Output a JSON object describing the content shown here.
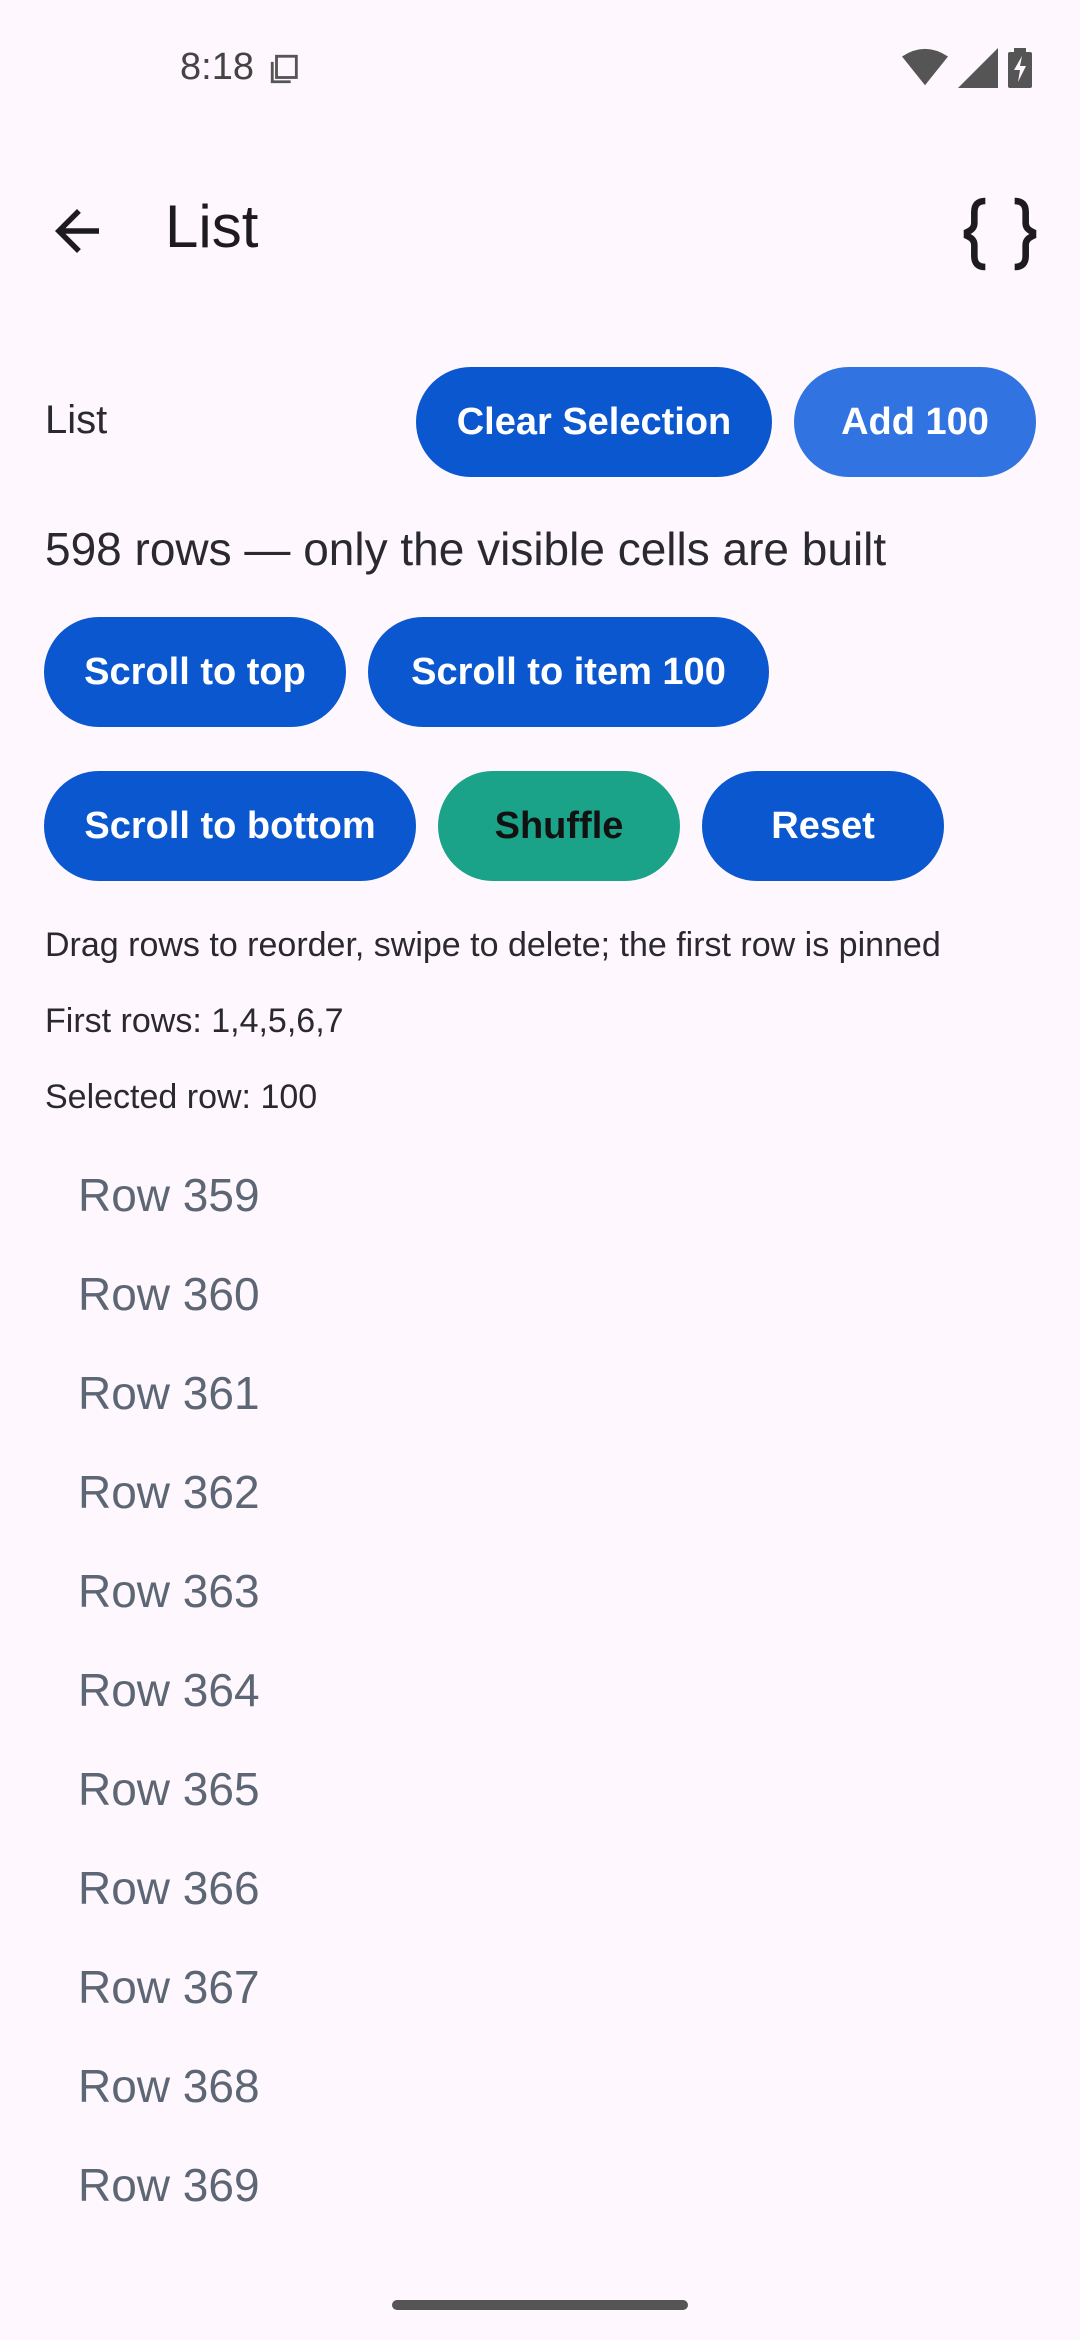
{
  "status_bar": {
    "time": "8:18",
    "icons": [
      "sim-card-icon",
      "wifi-icon",
      "signal-icon",
      "battery-charging-icon"
    ]
  },
  "app_bar": {
    "title": "List",
    "back_icon": "arrow-back-icon",
    "action_icon": "code-braces-icon"
  },
  "header": {
    "label": "List",
    "clear_selection_label": "Clear Selection",
    "add_label": "Add 100"
  },
  "info": "598 rows — only the visible cells are built",
  "controls": {
    "scroll_top_label": "Scroll to top",
    "scroll_item_label": "Scroll to item 100",
    "scroll_bottom_label": "Scroll to bottom",
    "shuffle_label": "Shuffle",
    "reset_label": "Reset"
  },
  "hint": "Drag rows to reorder, swipe to delete; the first row is pinned",
  "first_rows": "First rows: 1,4,5,6,7",
  "selected_row": "Selected row: 100",
  "rows": [
    "Row 359",
    "Row 360",
    "Row 361",
    "Row 362",
    "Row 363",
    "Row 364",
    "Row 365",
    "Row 366",
    "Row 367",
    "Row 368",
    "Row 369"
  ],
  "colors": {
    "primary": "#0B57D0",
    "primary_light": "#3173E0",
    "teal": "#1BA38A",
    "background": "#FEF7FD",
    "row_text": "#5C6674"
  }
}
